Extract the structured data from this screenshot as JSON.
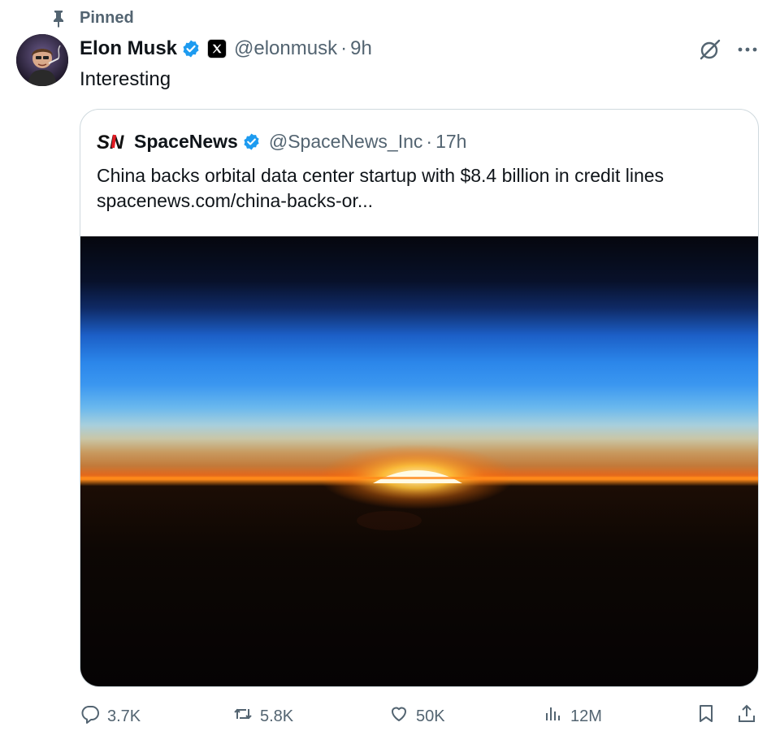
{
  "pinned": {
    "label": "Pinned",
    "icon": "pin-icon"
  },
  "author": {
    "name": "Elon Musk",
    "handle": "@elonmusk",
    "separator": "·",
    "time": "9h",
    "verified_color": "#1d9bf0",
    "avatar_icon": "avatar-image"
  },
  "tweet": {
    "text": "Interesting"
  },
  "quote": {
    "logo_text": "SN",
    "name": "SpaceNews",
    "handle": "@SpaceNews_Inc",
    "separator": "·",
    "time": "17h",
    "text_line1": "China backs orbital data center startup with $8.4 billion in credit lines",
    "text_line2": "spacenews.com/china-backs-or...",
    "image_icon": "earth-sunrise-image"
  },
  "actions": {
    "replies": "3.7K",
    "retweets": "5.8K",
    "likes": "50K",
    "views": "12M"
  },
  "colors": {
    "text_primary": "#0f1419",
    "text_secondary": "#536471",
    "border": "#cfd9de",
    "verified": "#1d9bf0",
    "spacenews_red": "#e31b23"
  }
}
